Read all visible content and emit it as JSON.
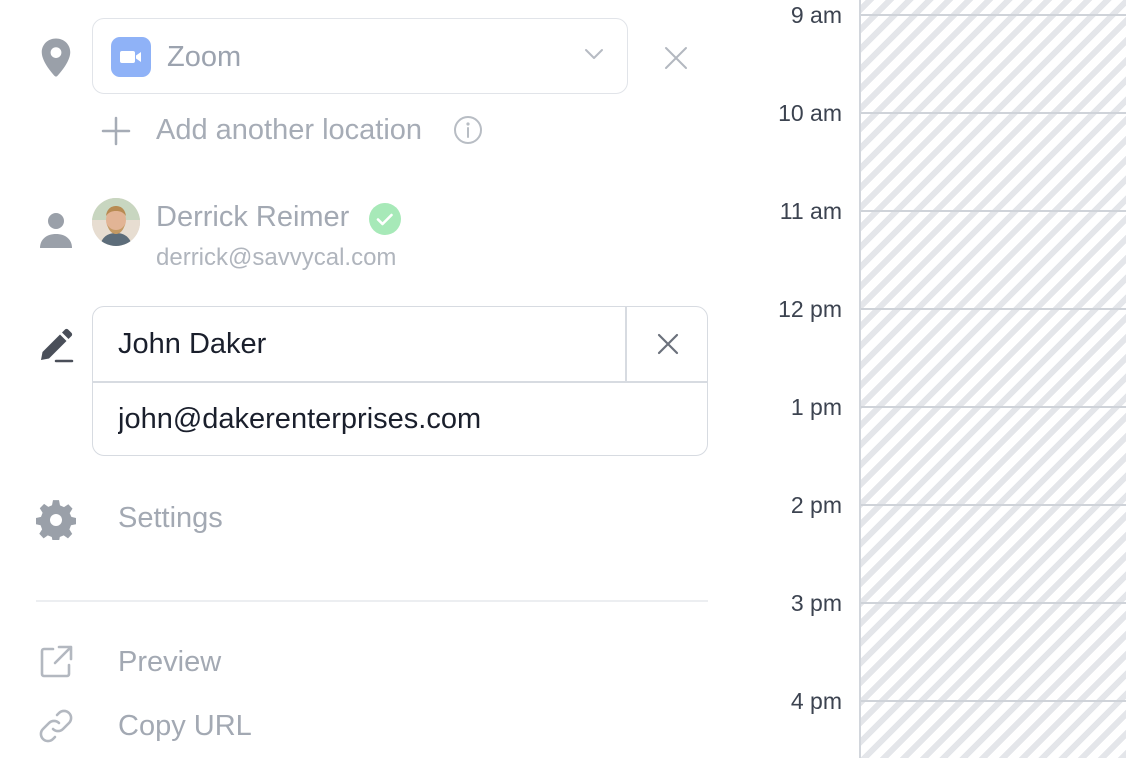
{
  "location": {
    "value": "Zoom",
    "add_label": "Add another location"
  },
  "host": {
    "name": "Derrick Reimer",
    "email": "derrick@savvycal.com"
  },
  "invitee": {
    "name": "John Daker",
    "email": "john@dakerenterprises.com"
  },
  "actions": {
    "settings_label": "Settings",
    "preview_label": "Preview",
    "copy_url_label": "Copy URL"
  },
  "calendar": {
    "hours": [
      "9 am",
      "10 am",
      "11 am",
      "12 pm",
      "1 pm",
      "2 pm",
      "3 pm",
      "4 pm"
    ]
  },
  "colors": {
    "zoom_badge": "#8fb2f7",
    "verified": "#a7e9b8",
    "muted_text": "#a3a9b3"
  }
}
